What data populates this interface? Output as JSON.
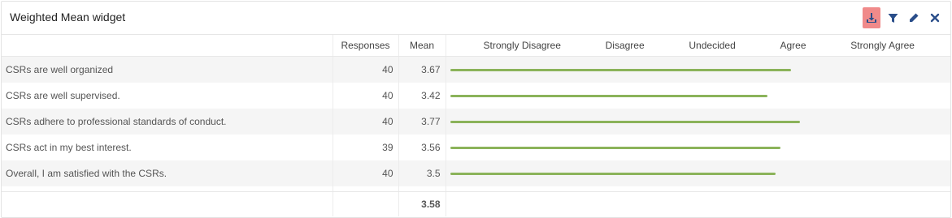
{
  "widget": {
    "title": "Weighted Mean widget",
    "icons": [
      "download-icon",
      "filter-icon",
      "edit-icon",
      "close-icon"
    ],
    "accent_active_icon_bg": "#f08a8a",
    "icon_color": "#2a4e8a"
  },
  "table": {
    "headers": {
      "responses": "Responses",
      "mean": "Mean",
      "scale": [
        "Strongly Disagree",
        "Disagree",
        "Undecided",
        "Agree",
        "Strongly Agree"
      ]
    },
    "rows": [
      {
        "label": "CSRs are well organized",
        "responses": "40",
        "mean": "3.67",
        "bar_value": 3.67
      },
      {
        "label": "CSRs are well supervised.",
        "responses": "40",
        "mean": "3.42",
        "bar_value": 3.42
      },
      {
        "label": "CSRs adhere to professional standards of conduct.",
        "responses": "40",
        "mean": "3.77",
        "bar_value": 3.77
      },
      {
        "label": "CSRs act in my best interest.",
        "responses": "39",
        "mean": "3.56",
        "bar_value": 3.56
      },
      {
        "label": "Overall, I am satisfied with the CSRs.",
        "responses": "40",
        "mean": "3.5",
        "bar_value": 3.5
      }
    ],
    "total_mean": "3.58",
    "bar_color": "#8bb35a"
  }
}
